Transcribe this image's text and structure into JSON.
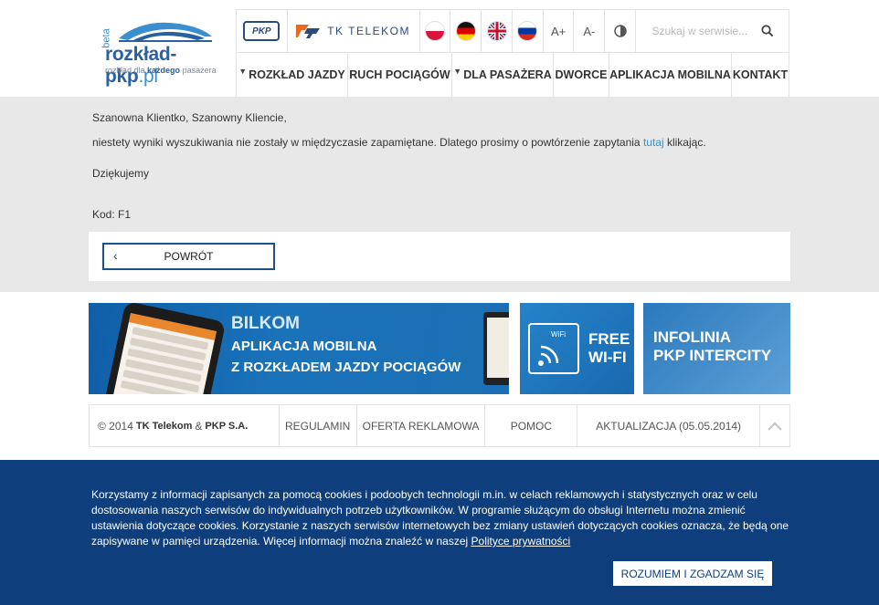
{
  "logo": {
    "beta": "beta",
    "brand": "rozkład-pkp",
    "brand_ext": ".pl",
    "tagline_pre": "rozkład dla",
    "tagline_bold": "każdego",
    "tagline_post": "pasażera"
  },
  "topbar": {
    "pkp_label": "PKP",
    "tk_label": "TK TELEKOM",
    "languages": [
      "polish-flag",
      "german-flag",
      "uk-flag",
      "russian-flag"
    ],
    "font_increase": "A+",
    "font_decrease": "A-",
    "contrast_icon": "contrast-icon",
    "search_placeholder": "Szukaj w serwisie..."
  },
  "nav": {
    "items": [
      {
        "label": "ROZKŁAD JAZDY",
        "dropdown": true
      },
      {
        "label": "RUCH POCIĄGÓW",
        "dropdown": false
      },
      {
        "label": "DLA PASAŻERA",
        "dropdown": true
      },
      {
        "label": "DWORCE",
        "dropdown": false
      },
      {
        "label": "APLIKACJA MOBILNA",
        "dropdown": false
      },
      {
        "label": "KONTAKT",
        "dropdown": false
      }
    ]
  },
  "message": {
    "greeting": "Szanowna Klientko, Szanowny Kliencie,",
    "body_pre": "niestety wyniki wyszukiwania nie zostały w międzyczasie zapamiętane. Dlatego prosimy o powtórzenie zapytania ",
    "body_link": "tutaj",
    "body_post": " klikając.",
    "thanks": "Dziękujemy",
    "code": "Kod: F1",
    "back_button": "POWRÓT"
  },
  "banners": {
    "bilkom_title": "BILKOM",
    "bilkom_line1": "APLIKACJA MOBILNA",
    "bilkom_line2": "Z ROZKŁADEM JAZDY POCIĄGÓW",
    "wifi_line1": "FREE",
    "wifi_line2": "WI-FI",
    "wifi_icon_label": "WiFi",
    "infolinia_line1": "INFOLINIA",
    "infolinia_line2": "PKP INTERCITY"
  },
  "footer": {
    "copyright_pre": "© 2014",
    "company1": "TK Telekom",
    "amp": "&",
    "company2": "PKP S.A.",
    "regulamin": "REGULAMIN",
    "oferta": "OFERTA REKLAMOWA",
    "pomoc": "POMOC",
    "aktualizacja": "AKTUALIZACJA (05.05.2014)"
  },
  "cookie": {
    "text": "Korzystamy z informacji zapisanych za pomocą cookies i podoobych technologii m.in. w celach reklamowych i statystycznych oraz w celu dostosowania naszych serwisów do indywidualnych potrzeb użytkowników. W programie służącym do obsługi Internetu można zmienić ustawienia dotyczące cookies. Korzystanie z naszych serwisów internetowych bez zmiany ustawień dotyczących cookies oznacza, że będą one zapisywane w pamięci urządzenia. Więcej informacji można znaleźć w naszej ",
    "link": "Polityce prywatności",
    "agree_button": "ROZUMIEM I ZGADZAM SIĘ"
  },
  "colors": {
    "brand_blue": "#2b5f9e",
    "link_blue": "#3b8fd0",
    "cookie_bg": "#0f3e7c",
    "gray_bg": "#e8e8e8"
  }
}
